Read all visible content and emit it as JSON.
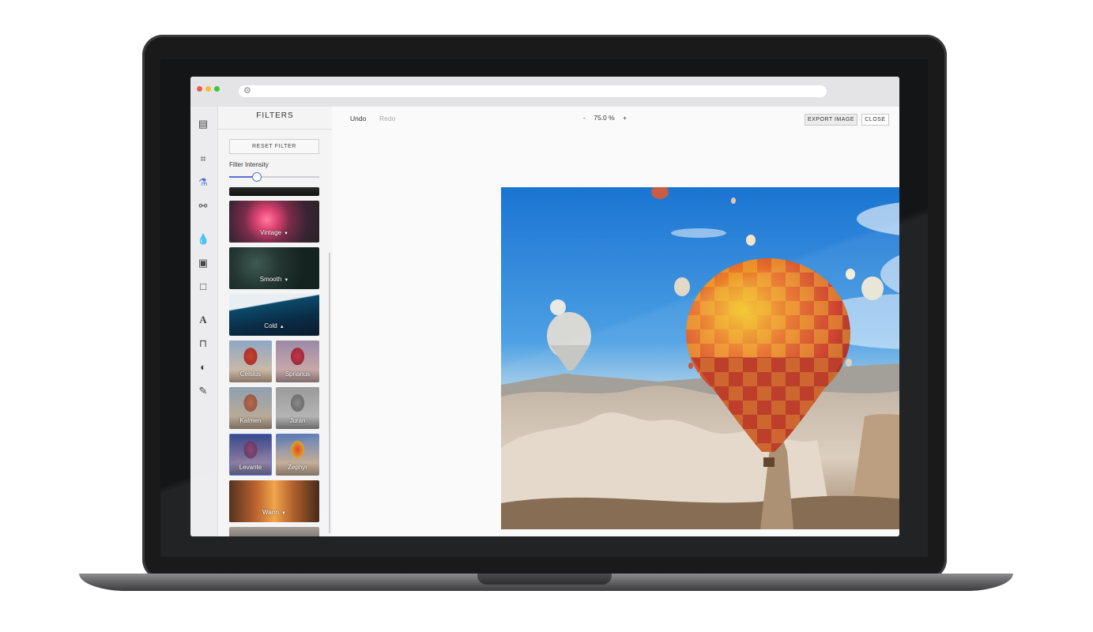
{
  "toolbar": {
    "undo": "Undo",
    "redo": "Redo",
    "zoom_minus": "-",
    "zoom_value": "75.0 %",
    "zoom_plus": "+",
    "export": "EXPORT IMAGE",
    "close": "CLOSE"
  },
  "sidebar": {
    "title": "FILTERS",
    "reset": "RESET FILTER",
    "intensity_label": "Filter Intensity",
    "intensity_value": 0.3,
    "filters": [
      {
        "label": "Vintage"
      },
      {
        "label": "Smooth"
      },
      {
        "label": "Cold"
      },
      {
        "label": "Celsius"
      },
      {
        "label": "Sprianus"
      },
      {
        "label": "Kalmen"
      },
      {
        "label": "Juran"
      },
      {
        "label": "Levante"
      },
      {
        "label": "Zephyr"
      },
      {
        "label": "Warm"
      }
    ]
  },
  "rail_icons": [
    "document-icon",
    "crop-icon",
    "filter-icon",
    "adjust-icon",
    "drop-icon",
    "frame-icon",
    "square-icon",
    "text-icon",
    "bookmark-icon",
    "palette-icon",
    "brush-icon"
  ],
  "colors": {
    "accent": "#5b6fd6"
  }
}
